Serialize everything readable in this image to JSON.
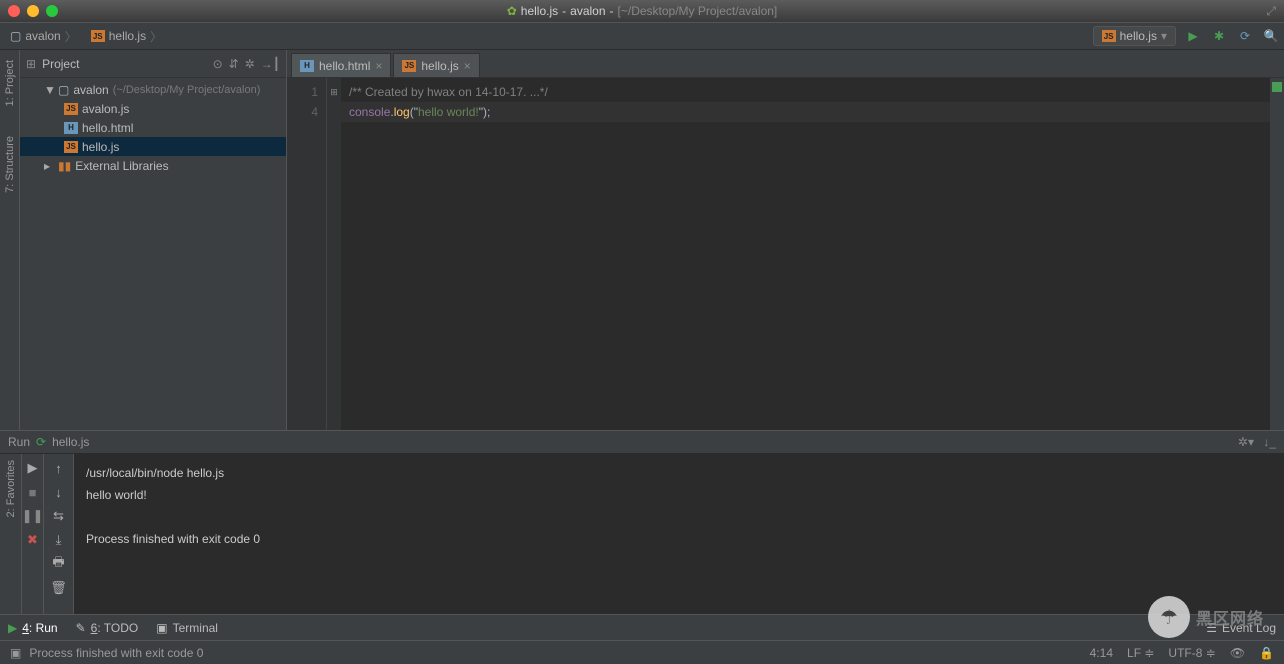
{
  "window": {
    "filename": "hello.js",
    "project": "avalon",
    "path": "[~/Desktop/My Project/avalon]"
  },
  "breadcrumb": {
    "items": [
      {
        "icon": "folder",
        "label": "avalon"
      },
      {
        "icon": "js",
        "label": "hello.js"
      }
    ]
  },
  "runConfig": {
    "selected": "hello.js"
  },
  "projectPanel": {
    "title": "Project",
    "root": {
      "label": "avalon",
      "path": "(~/Desktop/My Project/avalon)"
    },
    "files": [
      {
        "icon": "js",
        "label": "avalon.js"
      },
      {
        "icon": "html",
        "label": "hello.html"
      },
      {
        "icon": "js",
        "label": "hello.js",
        "selected": true
      }
    ],
    "external": "External Libraries"
  },
  "sideLabels": {
    "project": "1: Project",
    "structure": "7: Structure",
    "favorites": "2: Favorites"
  },
  "tabs": [
    {
      "icon": "html",
      "label": "hello.html",
      "active": false
    },
    {
      "icon": "js",
      "label": "hello.js",
      "active": true
    }
  ],
  "editor": {
    "lineNumbers": [
      "1",
      "4"
    ],
    "line1": "/** Created by hwax on 14-10-17. ...*/",
    "line2": {
      "obj": "console",
      "dot": ".",
      "fn": "log",
      "open": "(\"",
      "str": "hello world!",
      "close": "\");"
    }
  },
  "runHeader": {
    "label": "Run",
    "target": "hello.js"
  },
  "console": {
    "cmd": "/usr/local/bin/node hello.js",
    "out": "hello world!",
    "exit": "Process finished with exit code 0"
  },
  "bottomTools": {
    "run": "4: Run",
    "todo": "6: TODO",
    "terminal": "Terminal",
    "eventLog": "Event Log"
  },
  "status": {
    "message": "Process finished with exit code 0",
    "cursor": "4:14",
    "lineEnding": "LF",
    "encoding": "UTF-8"
  },
  "watermark": "黑区网络"
}
